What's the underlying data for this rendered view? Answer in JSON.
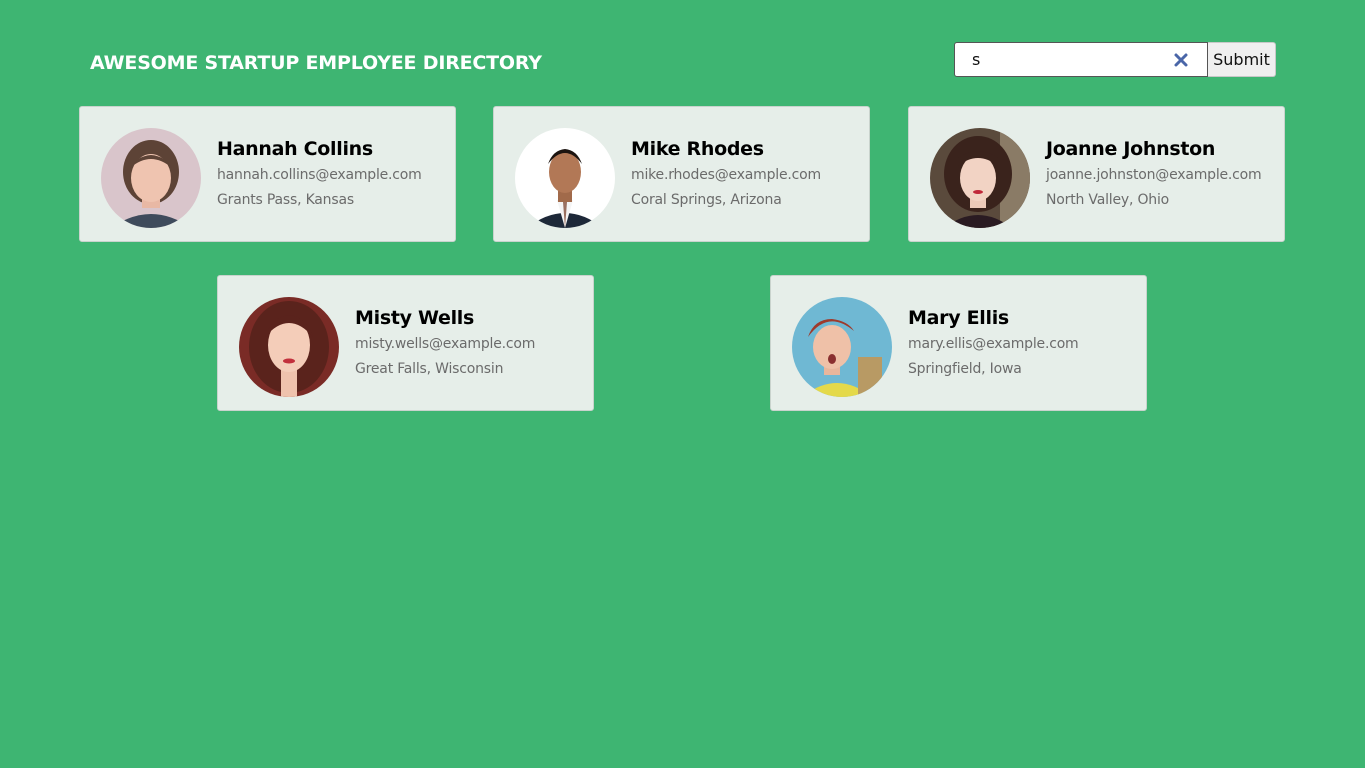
{
  "header": {
    "title": "AWESOME STARTUP EMPLOYEE DIRECTORY"
  },
  "search": {
    "value": "s",
    "clear_icon": "close-icon",
    "submit_label": "Submit"
  },
  "colors": {
    "background": "#3eb572",
    "card_background": "#e6eee9",
    "title_text": "#ffffff",
    "clear_icon": "#4a66a8"
  },
  "employees": [
    {
      "name": "Hannah Collins",
      "email": "hannah.collins@example.com",
      "location": "Grants Pass, Kansas"
    },
    {
      "name": "Mike Rhodes",
      "email": "mike.rhodes@example.com",
      "location": "Coral Springs, Arizona"
    },
    {
      "name": "Joanne Johnston",
      "email": "joanne.johnston@example.com",
      "location": "North Valley, Ohio"
    },
    {
      "name": "Misty Wells",
      "email": "misty.wells@example.com",
      "location": "Great Falls, Wisconsin"
    },
    {
      "name": "Mary Ellis",
      "email": "mary.ellis@example.com",
      "location": "Springfield, Iowa"
    }
  ]
}
